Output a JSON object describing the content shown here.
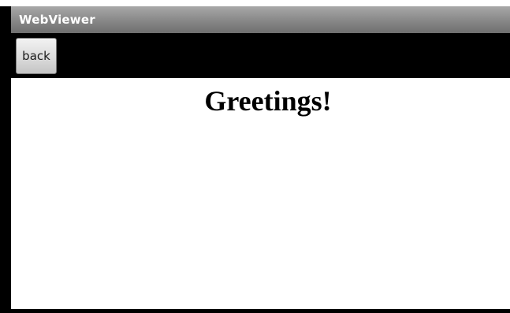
{
  "window": {
    "title": "WebViewer"
  },
  "toolbar": {
    "back_label": "back"
  },
  "page": {
    "heading": "Greetings!"
  },
  "colors": {
    "title_bar": "#8a8a8a",
    "toolbar": "#000000",
    "content_bg": "#ffffff"
  }
}
